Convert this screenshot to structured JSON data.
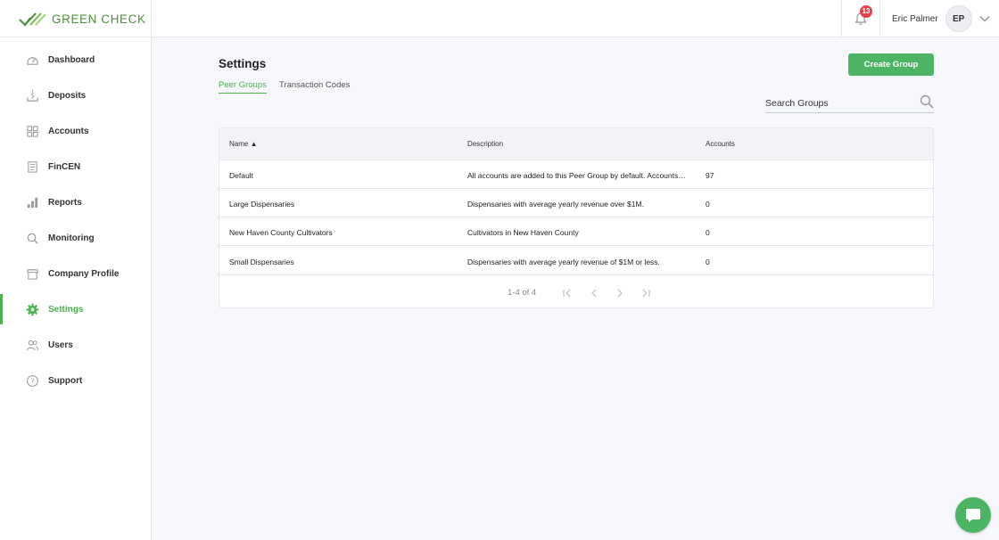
{
  "brand": {
    "name": "GREEN CHECK",
    "color": "#4a8f3c"
  },
  "header": {
    "notifications_count": "13",
    "user_name": "Eric Palmer",
    "user_initials": "EP"
  },
  "sidebar": {
    "items": [
      {
        "label": "Dashboard",
        "icon": "dashboard-icon"
      },
      {
        "label": "Deposits",
        "icon": "deposits-icon"
      },
      {
        "label": "Accounts",
        "icon": "grid-icon"
      },
      {
        "label": "FinCEN",
        "icon": "document-icon"
      },
      {
        "label": "Reports",
        "icon": "bar-chart-icon"
      },
      {
        "label": "Monitoring",
        "icon": "search-icon"
      },
      {
        "label": "Company Profile",
        "icon": "store-icon"
      },
      {
        "label": "Settings",
        "icon": "gear-icon",
        "active": true
      },
      {
        "label": "Users",
        "icon": "users-icon"
      },
      {
        "label": "Support",
        "icon": "help-icon"
      }
    ]
  },
  "main": {
    "title": "Settings",
    "create_button": "Create Group",
    "tabs": [
      {
        "label": "Peer Groups",
        "active": true
      },
      {
        "label": "Transaction Codes",
        "active": false
      }
    ],
    "search": {
      "placeholder": "Search Groups"
    },
    "table": {
      "columns": [
        "Name ▲",
        "Description",
        "Accounts"
      ],
      "rows": [
        {
          "name": "Default",
          "description": "All accounts are added to this Peer Group by default. Accounts …",
          "accounts": "97"
        },
        {
          "name": "Large Dispensaries",
          "description": "Dispensaries with average yearly revenue over $1M.",
          "accounts": "0"
        },
        {
          "name": "New Haven County Cultivators",
          "description": "Cultivators in New Haven County",
          "accounts": "0"
        },
        {
          "name": "Small Dispensaries",
          "description": "Dispensaries with average yearly revenue of $1M or less.",
          "accounts": "0"
        }
      ],
      "pagination": "1-4 of 4"
    }
  },
  "colors": {
    "accent": "#4caf50",
    "button": "#4cb564",
    "badge": "#e3424b"
  }
}
